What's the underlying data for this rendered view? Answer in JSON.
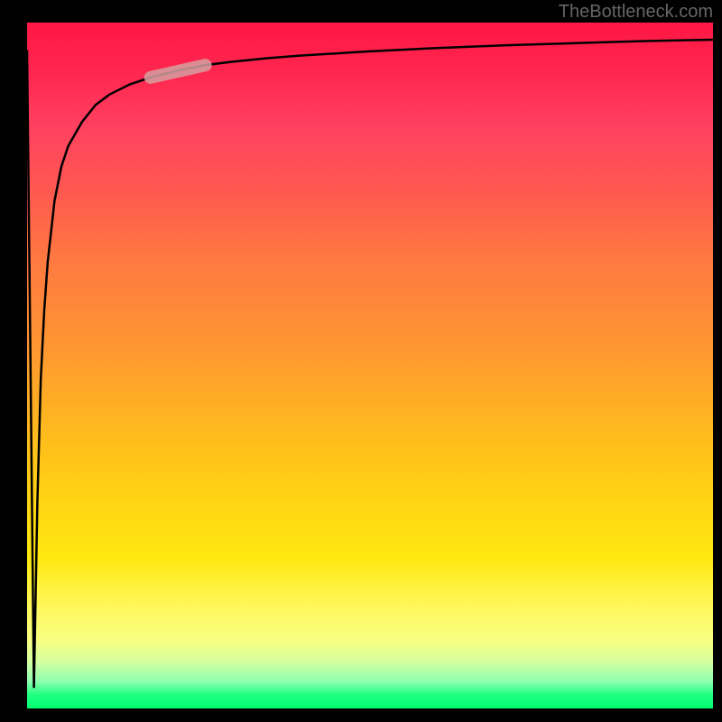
{
  "watermark": "TheBottleneck.com",
  "chart_data": {
    "type": "line",
    "title": "",
    "xlabel": "",
    "ylabel": "",
    "xlim": [
      0,
      100
    ],
    "ylim": [
      0,
      100
    ],
    "series": [
      {
        "name": "curve",
        "x": [
          0,
          0.5,
          1,
          1.5,
          2,
          2.5,
          3,
          4,
          5,
          6,
          8,
          10,
          12,
          15,
          18,
          22,
          26,
          30,
          35,
          40,
          50,
          60,
          70,
          80,
          90,
          100
        ],
        "y": [
          96,
          50,
          3,
          30,
          48,
          58,
          65,
          74,
          79,
          82,
          85.5,
          88,
          89.5,
          91,
          92,
          93,
          93.8,
          94.3,
          94.8,
          95.2,
          95.8,
          96.3,
          96.7,
          97,
          97.3,
          97.5
        ]
      }
    ],
    "highlight": {
      "x_start": 18,
      "x_end": 26,
      "y_start": 92,
      "y_end": 93.8
    },
    "gradient_colors": {
      "top": "#ff1744",
      "middle_upper": "#ff9830",
      "middle": "#ffe810",
      "middle_lower": "#fff75a",
      "bottom": "#00ff70"
    }
  }
}
